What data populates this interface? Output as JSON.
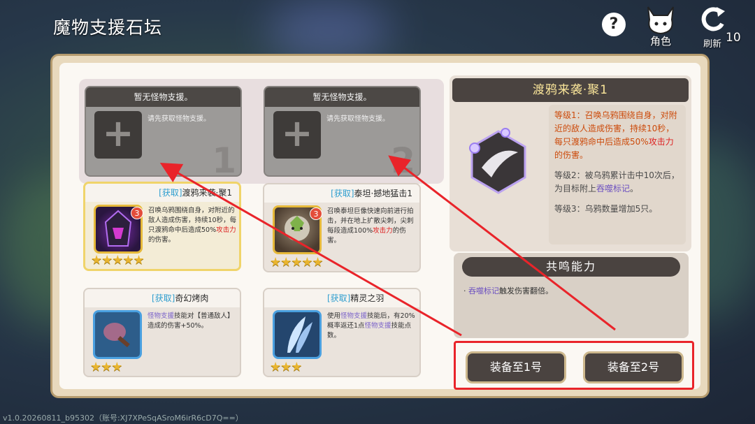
{
  "header": {
    "title": "魔物支援石坛",
    "help_label": "?",
    "character_label": "角色",
    "refresh_label": "刷新",
    "refresh_count": "10"
  },
  "slots": [
    {
      "title": "暂无怪物支援。",
      "hint": "请先获取怪物支援。",
      "number": "1"
    },
    {
      "title": "暂无怪物支援。",
      "hint": "请先获取怪物支援。",
      "number": "2"
    }
  ],
  "cards": [
    {
      "tag": "[获取]",
      "name": "渡鸦来袭·聚1",
      "badge": "3",
      "desc_a": "召唤乌鸦围绕自身，对附近的敌人造成伤害，持续10秒，每只渡鸦命中后造成50%",
      "desc_atk": "攻击力",
      "desc_b": "的伤害。",
      "stars": "★★★★★",
      "icon": "raven-helmet-icon"
    },
    {
      "tag": "[获取]",
      "name": "泰坦·撼地猛击1",
      "badge": "3",
      "desc_a": "召唤泰坦巨像快速向前进行拍击，并在地上扩散尖刺，尖刺每段造成100%",
      "desc_atk": "攻击力",
      "desc_b": "的伤害。",
      "stars": "★★★★★",
      "icon": "titan-creature-icon"
    },
    {
      "tag": "[获取]",
      "name": "奇幻烤肉",
      "kw": "怪物支援",
      "desc_a": "技能对【普通敌人】造成的伤害+50%。",
      "stars": "★★★",
      "icon": "roast-meat-icon"
    },
    {
      "tag": "[获取]",
      "name": "精灵之羽",
      "pre": "使用",
      "kw": "怪物支援",
      "desc_a": "技能后，有20%概率返还1点",
      "kw2": "怪物支援",
      "desc_b": "技能点数。",
      "stars": "★★★",
      "icon": "fairy-feather-icon"
    }
  ],
  "detail": {
    "title": "渡鸦来袭·聚1",
    "lv1_a": "等级1：召唤乌鸦围绕自身，对附近的敌人造成伤害，持续10秒，每只渡鸦命中后造成50%",
    "lv1_atk": "攻击力",
    "lv1_b": "的伤害。",
    "lv2_a": "等级2：被乌鸦累计击中10次后，为目标附上",
    "lv2_kw": "吞噬标记",
    "lv2_b": "。",
    "lv3": "等级3：乌鸦数量增加5只。",
    "icon": "raven-skill-icon"
  },
  "resonance": {
    "title": "共鸣能力",
    "bullet": "·",
    "kw": "吞噬标记",
    "text": "触发伤害翻倍。"
  },
  "equip": {
    "btn1": "装备至1号",
    "btn2": "装备至2号"
  },
  "version": "v1.0.20260811_b95302（账号:XJ7XPeSqASroM6irR6cD7Q==）",
  "colors": {
    "accent_red": "#e9242a",
    "title_gold": "#fbe69a",
    "frame": "#e8d9bd"
  }
}
